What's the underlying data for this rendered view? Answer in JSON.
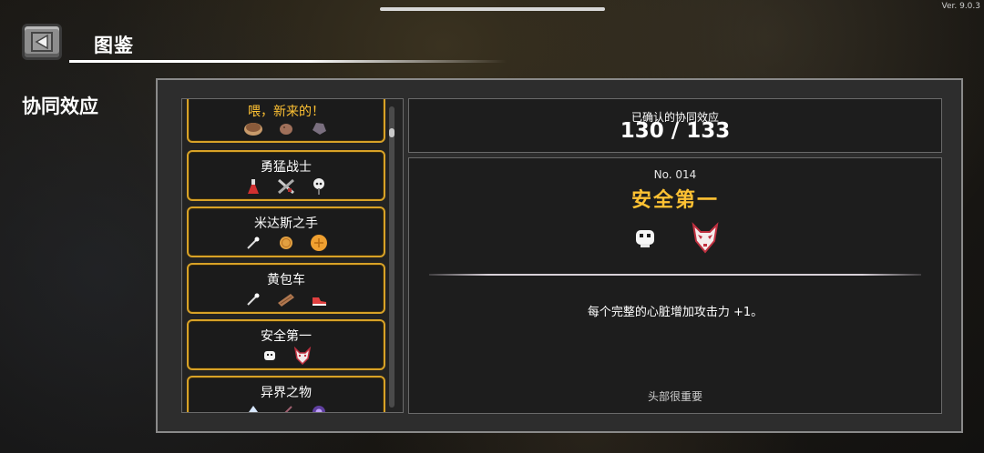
{
  "version": "Ver. 9.0.3",
  "header": {
    "title": "图鉴",
    "back_icon": "back-arrow-icon"
  },
  "section": {
    "label": "协同效应"
  },
  "synergy_list": [
    {
      "name": "喂，新来的！",
      "icons": [
        "pie-icon",
        "potato-icon",
        "stone-icon"
      ]
    },
    {
      "name": "勇猛战士",
      "icons": [
        "red-potion-icon",
        "crossed-swords-icon",
        "skull-staff-icon"
      ]
    },
    {
      "name": "米达斯之手",
      "icons": [
        "pin-icon",
        "gold-coin-icon",
        "gold-coin-large-icon"
      ]
    },
    {
      "name": "黄包车",
      "icons": [
        "pin-icon",
        "wooden-plank-icon",
        "red-sneaker-icon"
      ]
    },
    {
      "name": "安全第一",
      "icons": [
        "white-skull-icon",
        "fox-mask-icon"
      ]
    },
    {
      "name": "异界之物",
      "icons": [
        "crystal-icon",
        "wand-icon",
        "purple-orb-icon"
      ]
    }
  ],
  "summary": {
    "label": "已确认的协同效应",
    "value": "130 / 133"
  },
  "detail": {
    "number": "No. 014",
    "name": "安全第一",
    "icons": [
      "white-skull-icon",
      "fox-mask-icon"
    ],
    "description": "每个完整的心脏增加攻击力 +1。",
    "flavor": "头部很重要"
  },
  "colors": {
    "accent_gold": "#ffc233",
    "card_border": "#d8a227"
  }
}
